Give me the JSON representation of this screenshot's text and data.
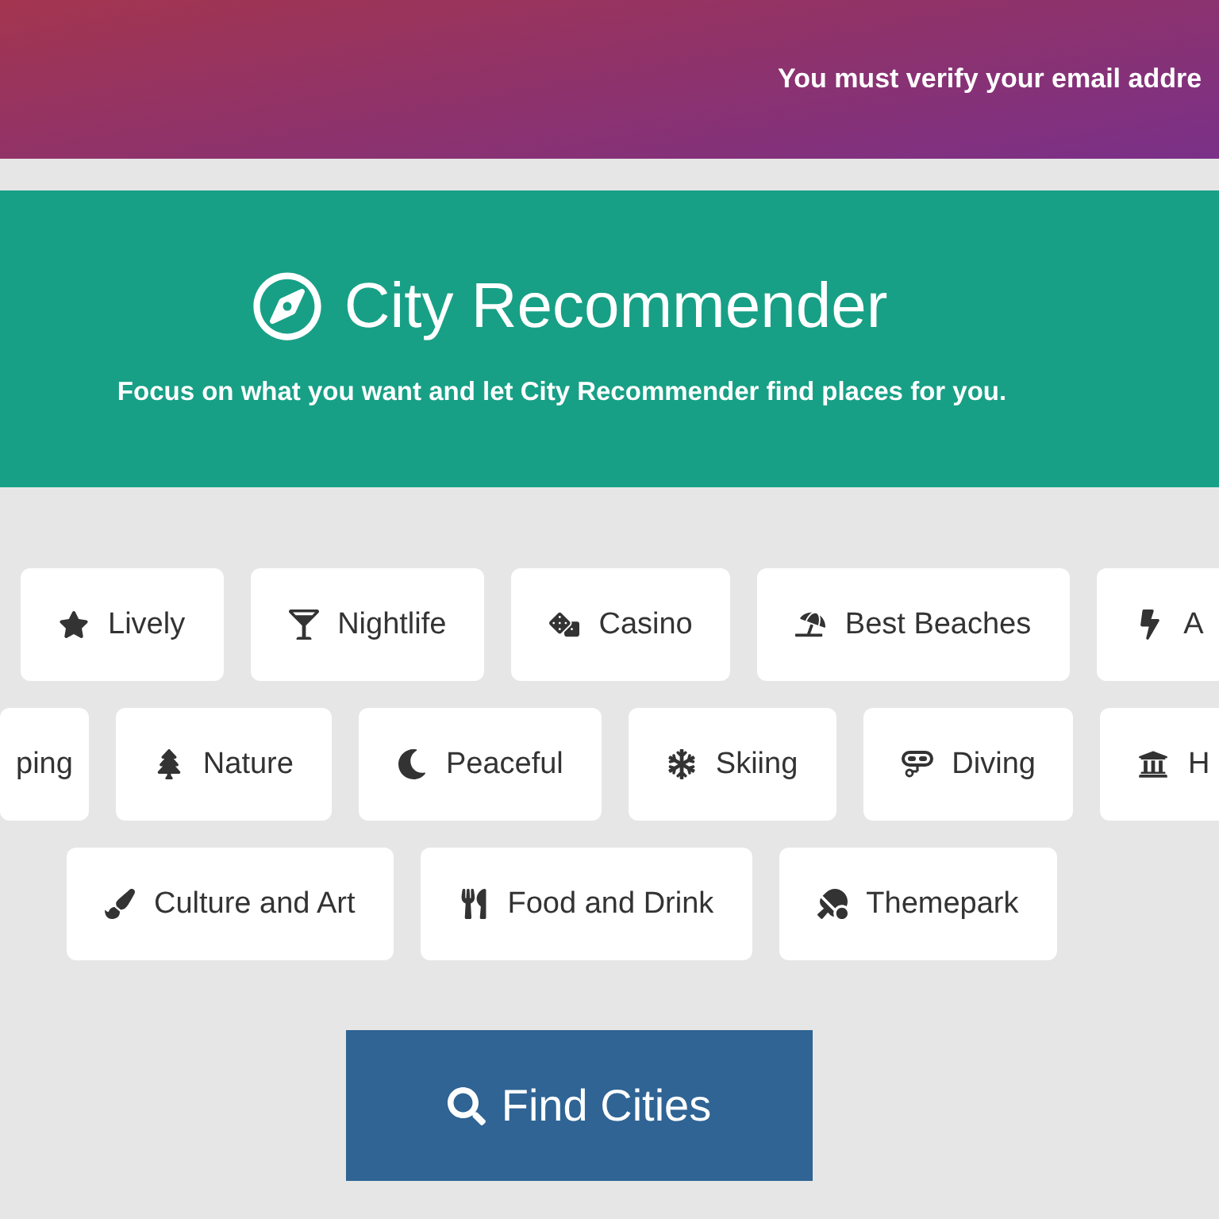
{
  "notice": "You must verify your email addre",
  "hero": {
    "title": "City Recommender",
    "subtitle": "Focus on what you want and let City Recommender find places for you."
  },
  "category_rows": [
    [
      "Lively",
      "Nightlife",
      "Casino",
      "Best Beaches",
      "A"
    ],
    [
      "ping",
      "Nature",
      "Peaceful",
      "Skiing",
      "Diving",
      "H"
    ],
    [
      "Culture and Art",
      "Food and Drink",
      "Themepark"
    ]
  ],
  "find_button": "Find Cities"
}
